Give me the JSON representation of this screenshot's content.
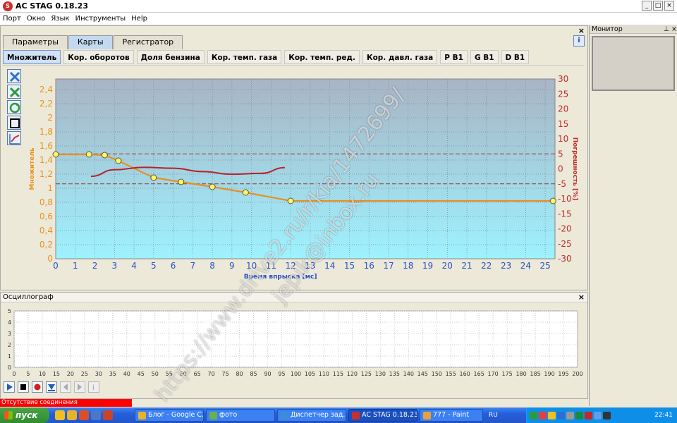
{
  "window": {
    "title": "AC STAG 0.18.23",
    "app_icon": "stag-logo-icon"
  },
  "menu": [
    "Порт",
    "Окно",
    "Язык",
    "Инструменты",
    "Help"
  ],
  "main_tabs": [
    {
      "label": "Параметры",
      "active": false
    },
    {
      "label": "Карты",
      "active": true
    },
    {
      "label": "Регистратор",
      "active": false
    }
  ],
  "help_button": "i",
  "sub_tabs": [
    {
      "label": "Множитель",
      "active": true
    },
    {
      "label": "Кор. оборотов",
      "active": false
    },
    {
      "label": "Доля бензина",
      "active": false
    },
    {
      "label": "Кор. темп. газа",
      "active": false
    },
    {
      "label": "Кор. темп. ред.",
      "active": false
    },
    {
      "label": "Кор. давл. газа",
      "active": false
    },
    {
      "label": "P B1",
      "active": false
    },
    {
      "label": "G B1",
      "active": false
    },
    {
      "label": "D B1",
      "active": false
    }
  ],
  "toolbar_icons": [
    "clear-x-icon",
    "delete-x-icon",
    "refresh-icon",
    "frame-icon",
    "autocalibrate-icon"
  ],
  "chart_data": {
    "type": "line",
    "xlabel": "Время впрыска [мс]",
    "ylabel_left": "Множитель",
    "ylabel_right": "Погрешность [%]",
    "x_ticks": [
      0,
      1,
      2,
      3,
      4,
      5,
      6,
      7,
      8,
      9,
      10,
      11,
      12,
      13,
      14,
      15,
      16,
      17,
      18,
      19,
      20,
      21,
      22,
      23,
      24,
      25
    ],
    "y_left_ticks": [
      "0",
      "0,2",
      "0,4",
      "0,6",
      "0,8",
      "1",
      "1,2",
      "1,4",
      "1,6",
      "1,8",
      "2",
      "2,2",
      "2,4"
    ],
    "y_right_ticks": [
      30,
      25,
      20,
      15,
      10,
      5,
      0,
      -5,
      -10,
      -15,
      -20,
      -25,
      -30
    ],
    "xlim": [
      0,
      25.5
    ],
    "ylim_left": [
      0,
      2.55
    ],
    "ylim_right": [
      -30,
      30
    ],
    "reference_lines_right": [
      5,
      -5
    ],
    "series": [
      {
        "color": "#e89020",
        "axis": "left",
        "points": [
          [
            0,
            1.48
          ],
          [
            1.7,
            1.48
          ],
          [
            2.5,
            1.47
          ],
          [
            3.2,
            1.39
          ],
          [
            5,
            1.15
          ],
          [
            6.4,
            1.09
          ],
          [
            8,
            1.02
          ],
          [
            9.7,
            0.94
          ],
          [
            12.0,
            0.82
          ],
          [
            25.4,
            0.82
          ]
        ],
        "markers": true
      },
      {
        "color": "#b8202a",
        "axis": "right",
        "points": [
          [
            1.8,
            -2.5
          ],
          [
            3,
            -0.3
          ],
          [
            4.5,
            0.5
          ],
          [
            6,
            0.2
          ],
          [
            7.5,
            -0.9
          ],
          [
            9,
            -1.8
          ],
          [
            10.5,
            -1.5
          ],
          [
            11.7,
            0.4
          ]
        ],
        "markers": false
      }
    ],
    "grid": true,
    "plot_bg_top": "#a8b4c4",
    "plot_bg_bottom": "#9ef2ff"
  },
  "right_panel": {
    "title": "Монитор",
    "pin": "pin-icon",
    "close": "×"
  },
  "oscilloscope": {
    "title": "Осциллограф",
    "close": "×",
    "y_ticks": [
      0,
      1,
      2,
      3,
      4,
      5
    ],
    "x_ticks": [
      0,
      5,
      10,
      15,
      20,
      25,
      30,
      35,
      40,
      45,
      50,
      55,
      60,
      65,
      70,
      75,
      80,
      85,
      90,
      95,
      100,
      105,
      110,
      115,
      120,
      125,
      130,
      135,
      140,
      145,
      150,
      155,
      160,
      165,
      170,
      175,
      180,
      185,
      190,
      195,
      200
    ],
    "controls": [
      "play-icon",
      "stop-icon",
      "record-icon",
      "download-icon",
      "prev-icon",
      "next-icon",
      "info-icon"
    ]
  },
  "status": {
    "error_text": "Отсутствие соединения",
    "error_color": "#ff0000"
  },
  "taskbar": {
    "start_label": "пуск",
    "tasks": [
      {
        "label": "Блог - Google C...",
        "icon_color": "#e8b22a",
        "active": false
      },
      {
        "label": "фото",
        "icon_color": "#6ab04c",
        "active": false
      },
      {
        "label": "Диспетчер зад...",
        "icon_color": "#3c8dd8",
        "active": false
      },
      {
        "label": "AC STAG 0.18.23",
        "icon_color": "#c9302c",
        "active": true
      },
      {
        "label": "777 - Paint",
        "icon_color": "#e8a23a",
        "active": false
      }
    ],
    "language": "RU",
    "clock": "22:41"
  },
  "watermark": {
    "line1": "jepik@inbox.ru",
    "line2": "https://www.drive2.ru/r/kia/1472699/"
  }
}
